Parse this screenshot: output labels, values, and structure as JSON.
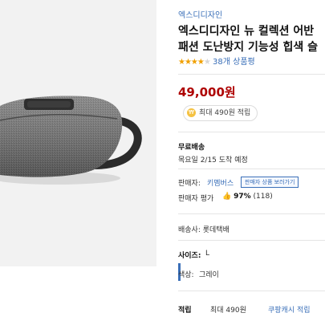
{
  "brand": "엑스디디자인",
  "title_line1": "엑스디디자인 뉴 컬렉션 어반",
  "title_line2": "패션 도난방지 기능성 힙색 슬",
  "rating": {
    "stars": 4,
    "count_text": "38개 상품평"
  },
  "price": "49,000원",
  "reward": {
    "icon": "coin-icon",
    "text": "최대 490원 적립"
  },
  "shipping": {
    "title": "무료배송",
    "eta": "목요일 2/15 도착 예정"
  },
  "seller": {
    "label": "판매자:",
    "name": "키멤버스",
    "button": "판매자 상품 보러가기"
  },
  "seller_rating": {
    "label": "판매자 평가",
    "icon": "thumbs-up-icon",
    "percent": "97%",
    "count": "(118)"
  },
  "delivery": {
    "text": "배송사: 롯데택배"
  },
  "size": {
    "label": "사이즈:",
    "value": "L"
  },
  "color": {
    "label": "색상:",
    "value": "그레이"
  },
  "points": {
    "label": "적립",
    "text": "최대 490원",
    "link": "쿠팡캐시 적립"
  },
  "colors": {
    "accent": "#3a6fb8",
    "price": "#ae0000",
    "star": "#f0a000"
  }
}
